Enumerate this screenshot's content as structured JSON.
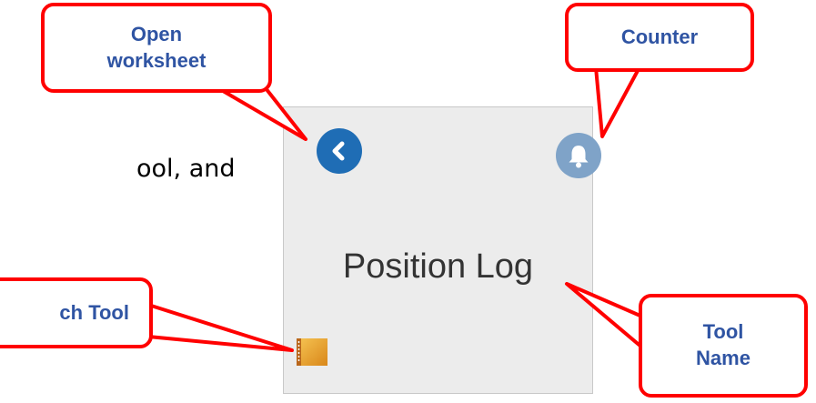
{
  "background_text": "ool, and",
  "tile": {
    "title": "Position Log",
    "back_icon": "chevron-left-icon",
    "counter_icon": "bell-icon",
    "launch_icon": "notebook-icon"
  },
  "callouts": {
    "open_worksheet": {
      "line1": "Open",
      "line2": "worksheet"
    },
    "counter": "Counter",
    "launch_tool": "ch Tool",
    "tool_name": {
      "line1": "Tool",
      "line2": "Name"
    }
  },
  "colors": {
    "callout_border": "#ff0000",
    "callout_text": "#2f54a3",
    "back_button": "#1f6db5",
    "counter_button": "#7fa3c8",
    "tile_background": "#ececec"
  }
}
